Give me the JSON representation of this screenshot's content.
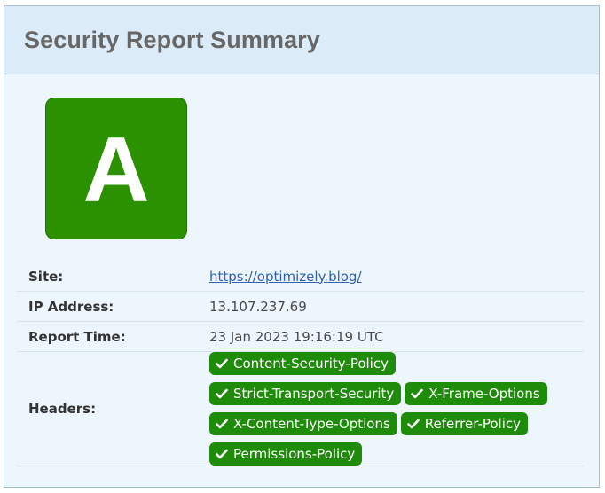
{
  "panel": {
    "title": "Security Report Summary"
  },
  "grade": {
    "letter": "A",
    "color": "#2c9100"
  },
  "info": {
    "site_label": "Site:",
    "site_value": "https://optimizely.blog/",
    "ip_label": "IP Address:",
    "ip_value": "13.107.237.69",
    "time_label": "Report Time:",
    "time_value": "23 Jan 2023 19:16:19 UTC",
    "headers_label": "Headers:"
  },
  "headers": [
    {
      "name": "Content-Security-Policy",
      "status": "present",
      "icon": "check-icon"
    },
    {
      "name": "Strict-Transport-Security",
      "status": "present",
      "icon": "check-icon"
    },
    {
      "name": "X-Frame-Options",
      "status": "present",
      "icon": "check-icon"
    },
    {
      "name": "X-Content-Type-Options",
      "status": "present",
      "icon": "check-icon"
    },
    {
      "name": "Referrer-Policy",
      "status": "present",
      "icon": "check-icon"
    },
    {
      "name": "Permissions-Policy",
      "status": "present",
      "icon": "check-icon"
    }
  ],
  "colors": {
    "header_badge": "#1e8b0a",
    "link": "#2f63b5",
    "panel_bg": "#eef6fd",
    "header_bg": "#dcebf8"
  }
}
